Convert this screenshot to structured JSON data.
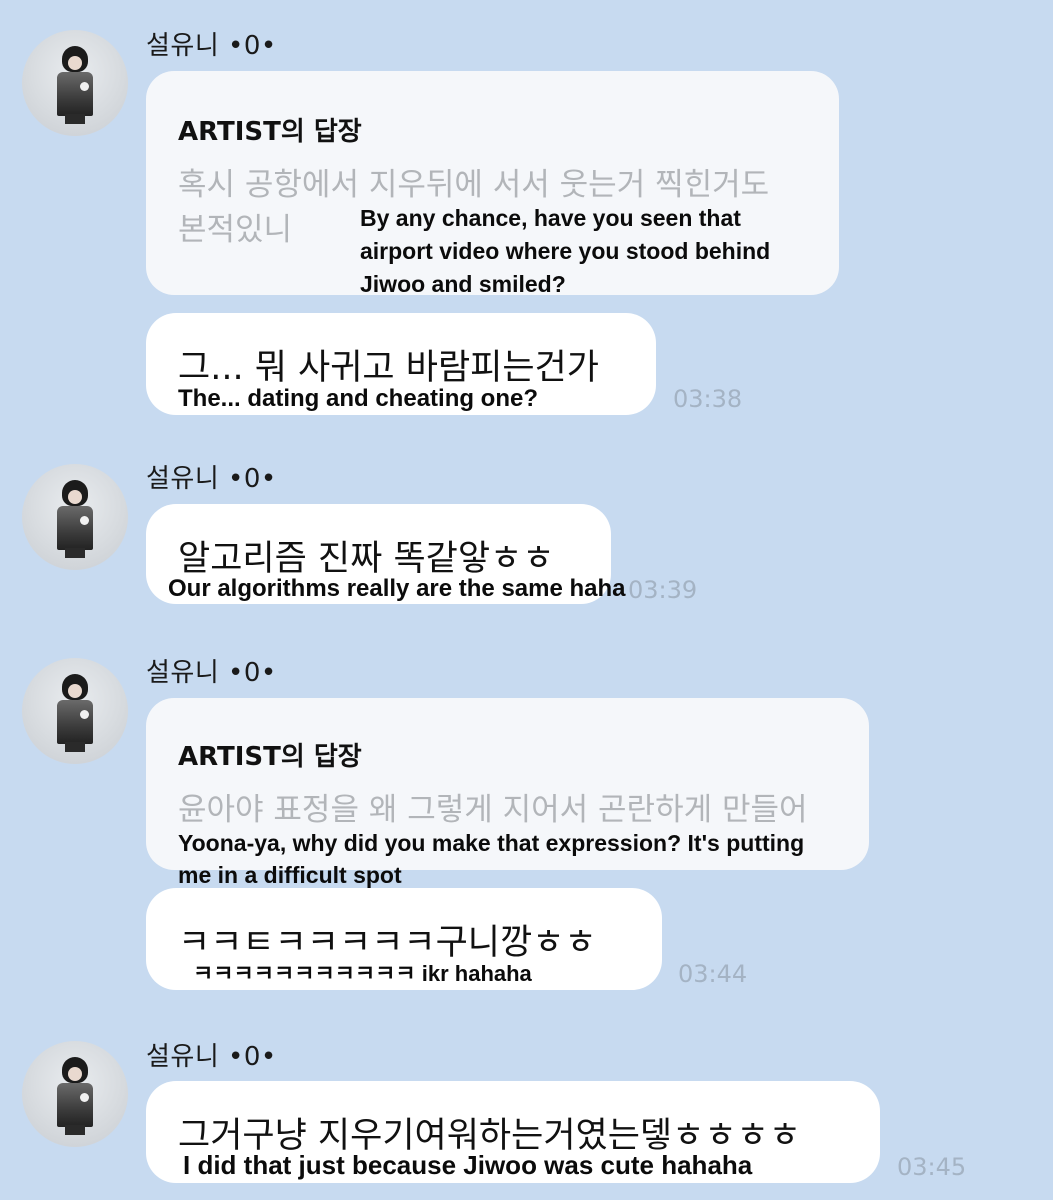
{
  "messages": [
    {
      "sender": "설유니 •0•",
      "reply_to": {
        "header": "ARTIST의 답장",
        "text_line1": "혹시 공항에서 지우뒤에 서서 웃는거 찍힌거도",
        "text_line2": "본적있니",
        "translation_line1": "By any chance, have you seen that",
        "translation_line2": "airport video where you stood behind",
        "translation_line3": "Jiwoo and smiled?"
      },
      "text": "그... 뭐 사귀고 바람피는건가",
      "translation": "The... dating and cheating one?",
      "time": "03:38"
    },
    {
      "sender": "설유니 •0•",
      "text": "알고리즘 진짜 똑같앟ㅎㅎ",
      "translation": "Our algorithms really are the same haha",
      "time": "03:39"
    },
    {
      "sender": "설유니 •0•",
      "reply_to": {
        "header": "ARTIST의 답장",
        "text_line1": "윤아야 표정을 왜 그렇게 지어서 곤란하게 만들어",
        "translation_line1": "Yoona-ya, why did you make that expression? It's putting",
        "translation_line2": "me in a difficult spot"
      },
      "text": "ㅋㅋㅌㅋㅋㅋㅋㅋ구니깡ㅎㅎ",
      "translation": "ㅋㅋㅋㅋㅋㅋㅋㅋㅋㅋㅋ ikr hahaha",
      "time": "03:44"
    },
    {
      "sender": "설유니 •0•",
      "text": "그거구냥 지우기여워하는거였는뎋ㅎㅎㅎㅎ",
      "translation": "I did that just because Jiwoo was cute hahaha",
      "time": "03:45"
    }
  ]
}
